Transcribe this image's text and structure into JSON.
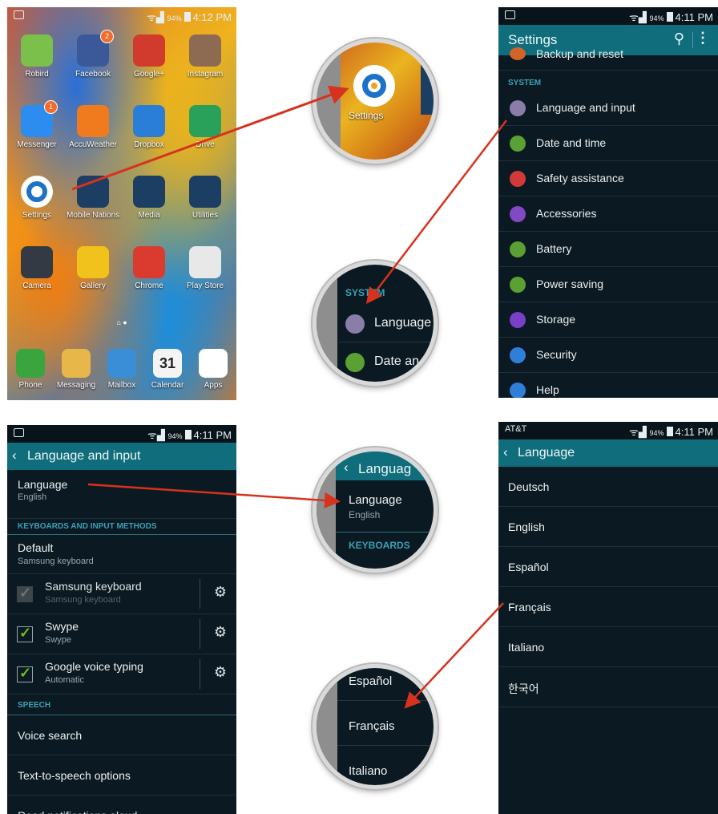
{
  "home": {
    "status": {
      "pct": "94%",
      "time": "4:12 PM"
    },
    "apps": [
      {
        "label": "Robird",
        "icon": "robird-icon",
        "color": "#7ac04a"
      },
      {
        "label": "Facebook",
        "icon": "facebook-icon",
        "color": "#3b5998",
        "badge": "2"
      },
      {
        "label": "Google+",
        "icon": "google-plus-icon",
        "color": "#d13b2e"
      },
      {
        "label": "Instagram",
        "icon": "instagram-icon",
        "color": "#8c6b52"
      },
      {
        "label": "Messenger",
        "icon": "messenger-icon",
        "color": "#2d8cf0",
        "badge": "1"
      },
      {
        "label": "AccuWeather",
        "icon": "accuweather-icon",
        "color": "#f07a1e"
      },
      {
        "label": "Dropbox",
        "icon": "dropbox-icon",
        "color": "#2a7ed8"
      },
      {
        "label": "Drive",
        "icon": "drive-icon",
        "color": "#2aa15a"
      },
      {
        "label": "Settings",
        "icon": "settings-icon",
        "color": "#1d72c8"
      },
      {
        "label": "Mobile Nations",
        "icon": "folder-icon",
        "color": "#1c3e63"
      },
      {
        "label": "Media",
        "icon": "folder-icon",
        "color": "#1c3e63"
      },
      {
        "label": "Utilities",
        "icon": "folder-icon",
        "color": "#1c3e63"
      },
      {
        "label": "Camera",
        "icon": "camera-icon",
        "color": "#333a44"
      },
      {
        "label": "Gallery",
        "icon": "gallery-icon",
        "color": "#f1c21b"
      },
      {
        "label": "Chrome",
        "icon": "chrome-icon",
        "color": "#db3b2f"
      },
      {
        "label": "Play Store",
        "icon": "play-store-icon",
        "color": "#e8e8e8"
      }
    ],
    "dock": [
      {
        "label": "Phone",
        "icon": "phone-icon",
        "color": "#3aa43e"
      },
      {
        "label": "Messaging",
        "icon": "messaging-icon",
        "color": "#e8b74a"
      },
      {
        "label": "Mailbox",
        "icon": "mailbox-icon",
        "color": "#3a8ed8"
      },
      {
        "label": "Calendar",
        "icon": "calendar-icon",
        "color": "#f4f4f4",
        "text": "31"
      },
      {
        "label": "Apps",
        "icon": "apps-grid-icon",
        "color": "#ffffff"
      }
    ]
  },
  "settings": {
    "status": {
      "pct": "94%",
      "time": "4:11 PM"
    },
    "title": "Settings",
    "partial_top": "Backup and reset",
    "section": "SYSTEM",
    "items": [
      {
        "label": "Language and input",
        "color": "#8a7ea8"
      },
      {
        "label": "Date and time",
        "color": "#5aa033"
      },
      {
        "label": "Safety assistance",
        "color": "#d23a3a"
      },
      {
        "label": "Accessories",
        "color": "#8248c6"
      },
      {
        "label": "Battery",
        "color": "#5aa033"
      },
      {
        "label": "Power saving",
        "color": "#5aa033"
      },
      {
        "label": "Storage",
        "color": "#7a3fc8"
      },
      {
        "label": "Security",
        "color": "#2f7fd8"
      },
      {
        "label": "Help",
        "color": "#2f7fd8"
      }
    ]
  },
  "mag_settings": {
    "label": "Settings"
  },
  "mag_system": {
    "section": "SYSTEM",
    "row1": "Language",
    "row2": "Date an"
  },
  "langinput": {
    "status": {
      "pct": "94%",
      "time": "4:11 PM"
    },
    "title": "Language and input",
    "language": {
      "label": "Language",
      "value": "English"
    },
    "section_keyboards": "KEYBOARDS AND INPUT METHODS",
    "default": {
      "label": "Default",
      "value": "Samsung keyboard"
    },
    "keyboards": [
      {
        "label": "Samsung keyboard",
        "sub": "Samsung keyboard",
        "checked": false
      },
      {
        "label": "Swype",
        "sub": "Swype",
        "checked": true
      },
      {
        "label": "Google voice typing",
        "sub": "Automatic",
        "checked": true
      }
    ],
    "section_speech": "SPEECH",
    "speech": [
      "Voice search",
      "Text-to-speech options",
      "Read notifications aloud"
    ]
  },
  "mag_language": {
    "header": "Languag",
    "label": "Language",
    "value": "English",
    "section": "KEYBOARDS"
  },
  "language_list": {
    "status": {
      "carrier": "AT&T",
      "pct": "94%",
      "time": "4:11 PM"
    },
    "title": "Language",
    "items": [
      "Deutsch",
      "English",
      "Español",
      "Français",
      "Italiano",
      "한국어"
    ]
  },
  "mag_langs": {
    "items": [
      "Español",
      "Français",
      "Italiano"
    ]
  }
}
